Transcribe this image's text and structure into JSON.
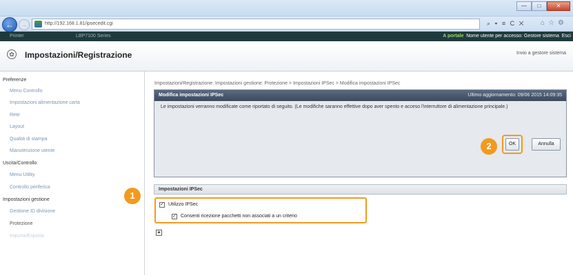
{
  "browser": {
    "url": "http://192.168.1.81/ipsecedit.cgi",
    "tools": "⌕ ▾ ≡ C ✕",
    "window_buttons": [
      "—",
      "□",
      "✕"
    ]
  },
  "portal": {
    "left_text": "Printer",
    "left_text2": "LBP7100 Series",
    "link": "A portale",
    "user_label": "Nome utente per accesso:",
    "user_value": "Gestore sistema",
    "exit": "Esci"
  },
  "header": {
    "title": "Impostazioni/Registrazione",
    "right_link": "Invio a gestore sistema"
  },
  "nav": {
    "sections": [
      {
        "label": "Preferenze",
        "items": [
          "Menu Controllo",
          "Impostazioni alimentazione carta",
          "Rete",
          "Layout",
          "Qualità di stampa",
          "Manutenzione utente"
        ]
      },
      {
        "label": "Uscita/Controllo",
        "items": [
          "Menu Utility",
          "Controllo periferica"
        ]
      },
      {
        "label": "Impostazioni gestione",
        "items": [
          "Gestione ID divisione",
          "Protezione",
          "Importa/Esporta"
        ]
      }
    ]
  },
  "main": {
    "breadcrumb": "Impostazioni/Registrazione: Impostazioni gestione: Protezione > Impostazioni IPSec > Modifica impostazioni IPSec",
    "panel_title": "Modifica impostazioni IPSec",
    "last_update": "Ultimo aggiornamento: 09/06 2015 14:09:35",
    "message": "Le impostazioni verranno modificate come riportato di seguito. (Le modifiche saranno effettive dopo aver spento e acceso l'interruttore di alimentazione principale.)",
    "ok_label": "OK",
    "cancel_label": "Annulla",
    "section_title": "Impostazioni IPSec",
    "checkbox1": "Utilizzo IPSec",
    "checkbox2": "Consenti ricezione pacchetti non associati a un criterio",
    "badge1": "1",
    "badge2": "2"
  }
}
